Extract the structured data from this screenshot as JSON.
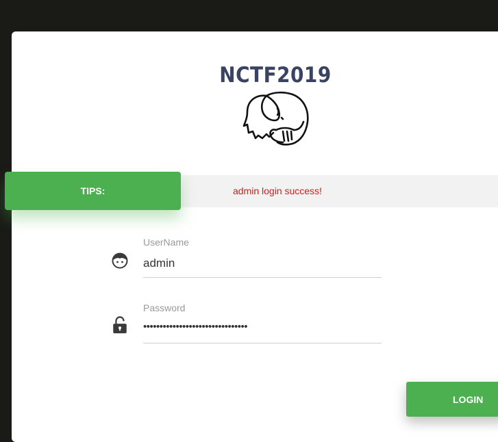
{
  "app": {
    "title": "NCTF2019"
  },
  "tips": {
    "label": "TIPS:",
    "message": "admin login success!"
  },
  "form": {
    "username": {
      "label": "UserName",
      "value": "admin"
    },
    "password": {
      "label": "Password",
      "value": "••••••••••••••••••••••••••••••••"
    },
    "login_label": "LOGIN"
  },
  "colors": {
    "accent": "#4caf50",
    "error": "#d61b1b",
    "title": "#3a4462",
    "background": "#1a1a16"
  },
  "icons": {
    "logo": "elephant-logo",
    "username": "user-face-icon",
    "password": "unlock-icon"
  }
}
